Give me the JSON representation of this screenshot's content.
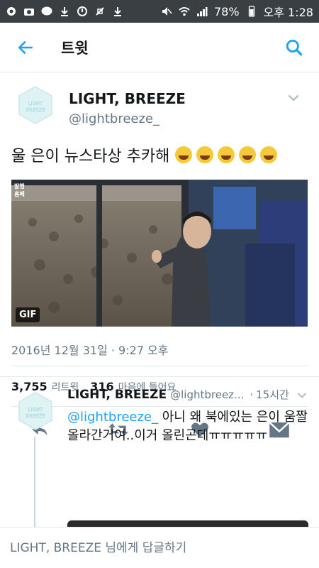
{
  "status_bar": {
    "left_icons": [
      "signal-app-icon",
      "camera-icon",
      "talk-icon",
      "download-icon",
      "sync-icon",
      "mute-icon",
      "download-icon"
    ],
    "talk_label": "TALK",
    "battery_text": "78%",
    "clock": "오후 1:28"
  },
  "appbar": {
    "title": "트윗"
  },
  "tweet": {
    "author_name": "LIGHT, BREEZE",
    "author_handle": "@lightbreeze_",
    "avatar_text": [
      "LIGHT",
      "BREEZE"
    ],
    "text": "울 은이 뉴스타상 추카해",
    "emoji_count": 5,
    "gif_label": "GIF",
    "watermark": "발행\n홈페",
    "timestamp": "2016년 12월 31일 · 9:27 오후",
    "retweets_count": "3,755",
    "retweets_label": "리트윗",
    "likes_count": "316",
    "likes_label": "마음에 들어요"
  },
  "reply": {
    "author_name": "LIGHT, BREEZE",
    "author_handle": "@lightbreez...",
    "dot": "·",
    "time": "15시간",
    "mention": "@lightbreeze_",
    "text": " 아니 왜 북에있는 은이 움짤 올라간거여..이거 올린곤데ㅠㅠㅠㅠㅠ"
  },
  "compose": {
    "placeholder": "LIGHT, BREEZE 님에게 답글하기"
  },
  "colors": {
    "accent": "#1da1f2",
    "text": "#14171a",
    "secondary": "#657786",
    "status_bar": "#3a3f44"
  }
}
